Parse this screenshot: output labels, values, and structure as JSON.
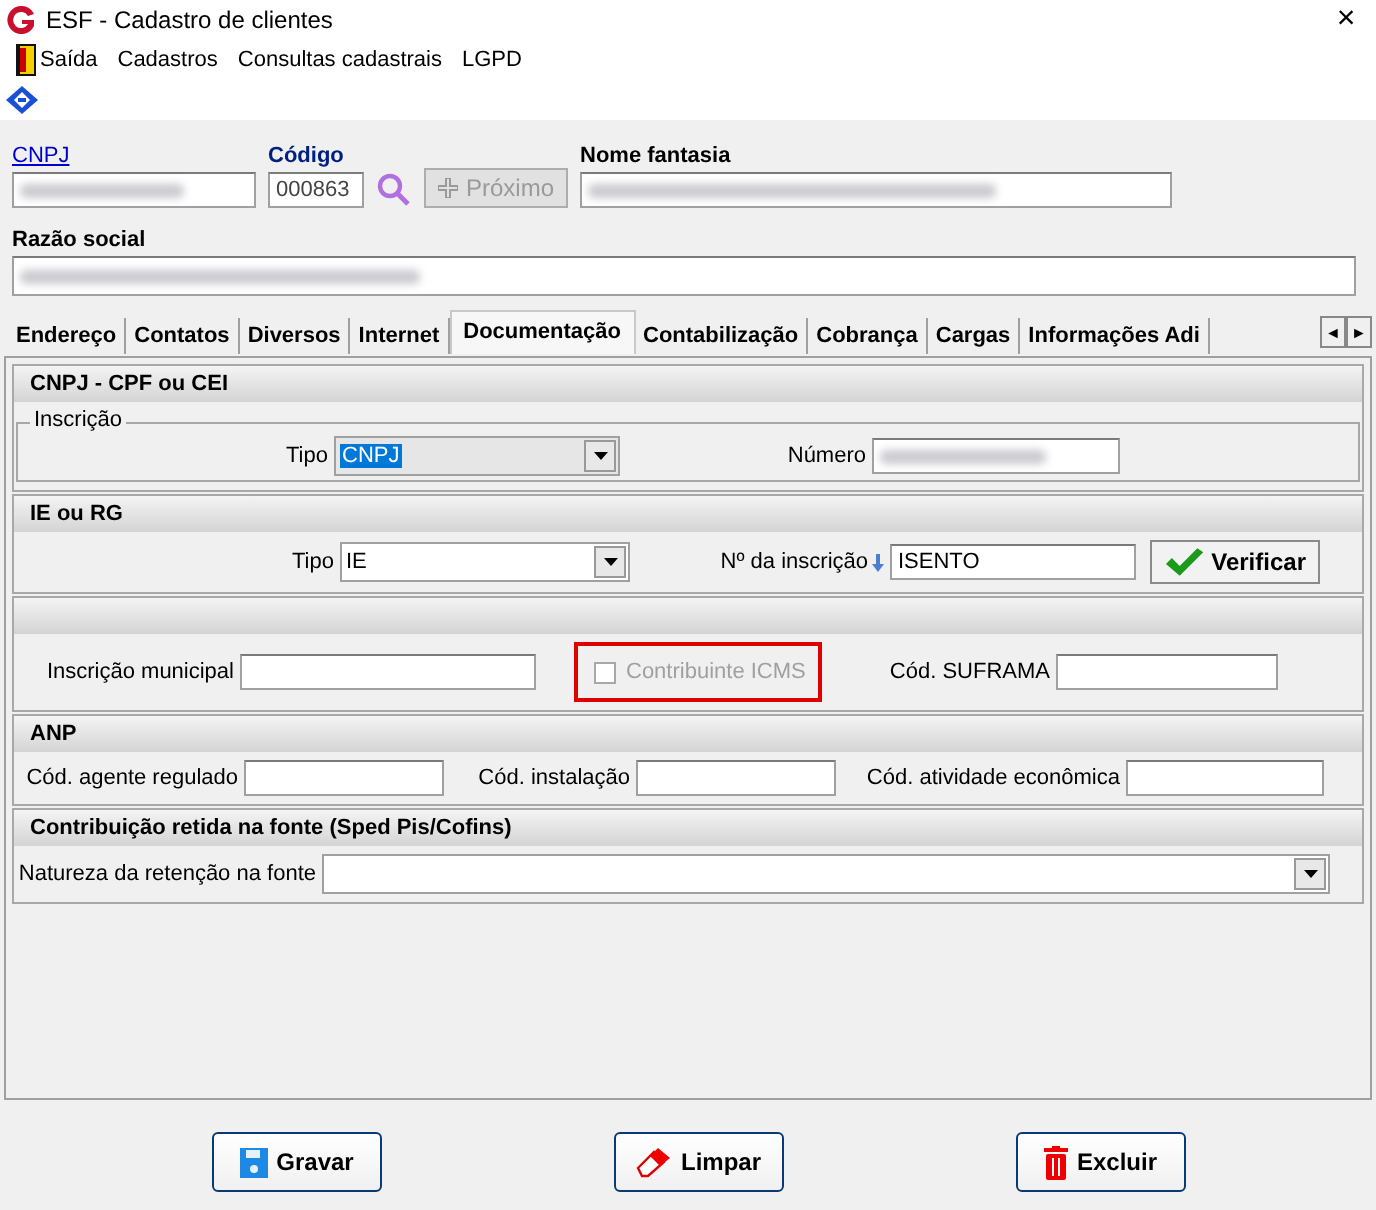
{
  "window": {
    "title": "ESF - Cadastro de clientes",
    "close": "×"
  },
  "menu": [
    {
      "label": "Saída",
      "kind": "exit"
    },
    {
      "label": "Cadastros"
    },
    {
      "label": "Consultas cadastrais"
    },
    {
      "label": "LGPD"
    }
  ],
  "header": {
    "cnpj": {
      "label": "CNPJ",
      "redacted": true
    },
    "codigo": {
      "label": "Código",
      "value": "000863"
    },
    "next_button": {
      "label": "Próximo",
      "disabled": true
    },
    "nome_fantasia": {
      "label": "Nome fantasia",
      "redacted": true
    },
    "razao_social": {
      "label": "Razão social",
      "redacted": true
    }
  },
  "tabs": [
    {
      "label": "Endereço",
      "selected": false
    },
    {
      "label": "Contatos",
      "selected": false
    },
    {
      "label": "Diversos",
      "selected": false
    },
    {
      "label": "Internet",
      "selected": false
    },
    {
      "label": "Documentação",
      "selected": true
    },
    {
      "label": "Contabilização",
      "selected": false
    },
    {
      "label": "Cobrança",
      "selected": false
    },
    {
      "label": "Cargas",
      "selected": false
    },
    {
      "label": "Informações Adi",
      "selected": false
    }
  ],
  "tab_scroll": {
    "left": "◄",
    "right": "►"
  },
  "sections": [
    {
      "title": "CNPJ - CPF ou CEI",
      "group": "Inscrição",
      "fields": [
        {
          "kind": "select",
          "label": "Tipo",
          "value": "CNPJ",
          "highlighted_value": true
        },
        {
          "kind": "input",
          "label": "Número",
          "redacted": true
        }
      ]
    },
    {
      "title": "IE ou RG",
      "fields": [
        {
          "kind": "select",
          "label": "Tipo",
          "value": "IE",
          "highlighted_value": false
        },
        {
          "kind": "input",
          "label": "Nº da inscrição",
          "value": "ISENTO",
          "hint_icon": true
        },
        {
          "kind": "button",
          "label": "Verificar"
        }
      ]
    },
    {
      "fields": [
        {
          "kind": "input",
          "label": "Inscrição municipal"
        },
        {
          "kind": "checkbox",
          "label": "Contribuinte ICMS",
          "checked": false,
          "disabled": true,
          "highlighted": true
        },
        {
          "kind": "input",
          "label": "Cód. SUFRAMA"
        }
      ]
    },
    {
      "title": "ANP",
      "fields": [
        {
          "kind": "input",
          "label": "Cód. agente regulado"
        },
        {
          "kind": "input",
          "label": "Cód. instalação"
        },
        {
          "kind": "input",
          "label": "Cód. atividade econômica"
        }
      ]
    },
    {
      "title": "Contribuição retida na fonte  (Sped Pis/Cofins)",
      "fields": [
        {
          "kind": "select",
          "label": "Natureza da retenção na fonte",
          "highlighted_value": false
        }
      ]
    }
  ],
  "buttons": [
    {
      "label": "Gravar",
      "kind": "save"
    },
    {
      "label": "Limpar",
      "kind": "clear"
    },
    {
      "label": "Excluir",
      "kind": "delete"
    }
  ]
}
